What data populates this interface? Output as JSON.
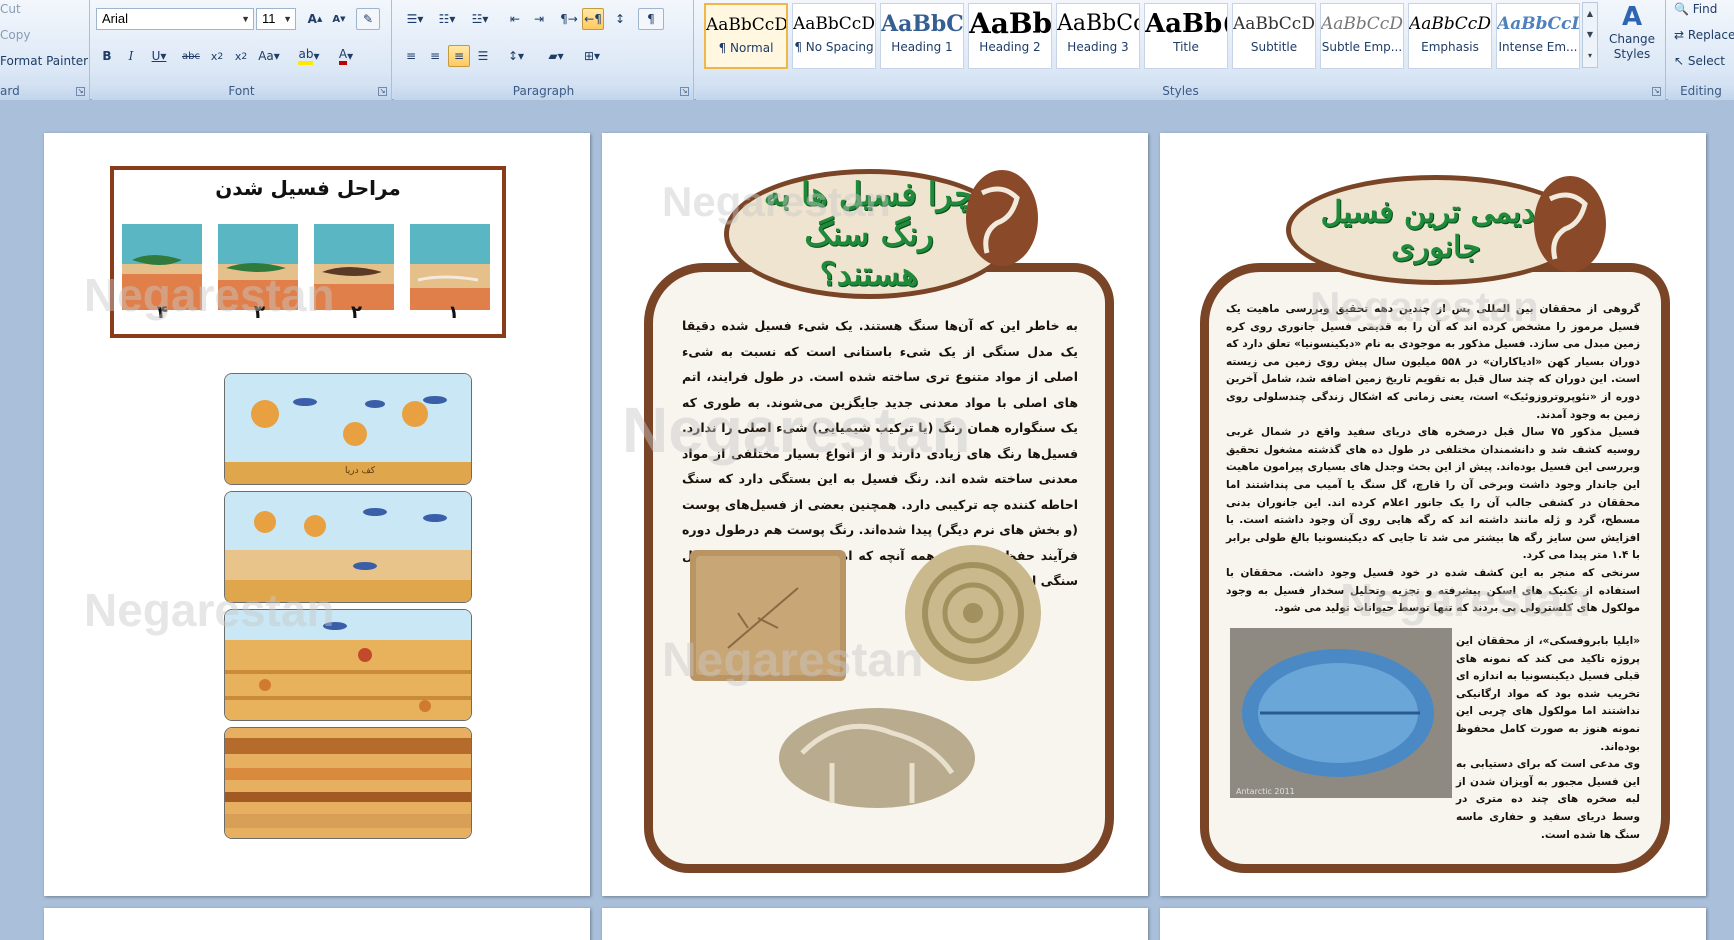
{
  "ribbon": {
    "clipboard": {
      "cut": "Cut",
      "copy": "Copy",
      "format_painter": "Format Painter",
      "label": "ard"
    },
    "font": {
      "name": "Arial",
      "size": "11",
      "label": "Font"
    },
    "paragraph": {
      "label": "Paragraph"
    },
    "styles": {
      "label": "Styles",
      "items": [
        {
          "preview": "AaBbCcDd",
          "name": "¶ Normal"
        },
        {
          "preview": "AaBbCcDd",
          "name": "¶ No Spacing"
        },
        {
          "preview": "AaBbCc",
          "name": "Heading 1"
        },
        {
          "preview": "AaBb",
          "name": "Heading 2"
        },
        {
          "preview": "AaBbCc",
          "name": "Heading 3"
        },
        {
          "preview": "AaBb(",
          "name": "Title"
        },
        {
          "preview": "AaBbCcD",
          "name": "Subtitle"
        },
        {
          "preview": "AaBbCcDd",
          "name": "Subtle Emp..."
        },
        {
          "preview": "AaBbCcDd",
          "name": "Emphasis"
        },
        {
          "preview": "AaBbCcDd",
          "name": "Intense Em..."
        }
      ],
      "change_styles": "Change Styles"
    },
    "editing": {
      "find": "Find",
      "replace": "Replace",
      "select": "Select",
      "label": "Editing"
    }
  },
  "pages": {
    "left": {
      "stages_title": "مراحل فسیل شدن",
      "stage_numbers": [
        "۴",
        "۳",
        "۲",
        "۱"
      ],
      "strip_caption": "کف دریا"
    },
    "middle": {
      "title": "چرا فسیل ها به رنگ سنگ هستند؟",
      "body": "به خاطر این که آن‌ها سنگ هستند. یک شیء فسیل شده دقیقا یک مدل سنگی از یک شیء باستانی است که نسبت به شیء اصلی از مواد متنوع تری ساخته شده است. در طول فرایند، اتم های اصلی با مواد معدنی جدید جایگزین می‌شوند. به طوری که یک سنگواره همان رنگ (یا ترکیب شیمیایی) شیء اصلی را ندارد. فسیل‌ها رنگ های زیادی دارند و از انواع بسیار مختلفی از مواد معدنی ساخته شده اند. رنگ فسیل به این بستگی دارد که سنگ احاطه کننده چه ترکیبی دارد. همچنین بعضی از فسیل‌های پوست (و بخش های نرم دیگر) پیدا شده‌اند. رنگ پوست هم درطول دوره فرآیند حفظ نمی‌شود. همه آنچه که امروزه باقی مانده یک مدل سنگی از شیء اصلی است."
    },
    "right": {
      "title": "قدیمی ترین فسیل جانوری",
      "p1": "گروهی از محققان بین المللی پس از چندین دهه تحقیق وبررسی ماهیت یک فسیل مرموز را مشخص کرده اند که آن را به قدیمی فسیل جانوری روی کره زمین مبدل می سازد. فسیل مذکور به موجودی به نام «دیکینسونیا» تعلق دارد که دوران بسیار کهن «ادیاکاران» در ۵۵۸ میلیون سال پیش روی زمین می زیسته است. این دوران که چند سال قبل به تقویم تاریخ زمین اضافه شد، شامل آخرین دوره از «نئوپروتروزوئیک» است، یعنی زمانی که اشکال زندگی چندسلولی روی زمین به وجود آمدند.",
      "p2": "فسیل مذکور ۷۵ سال قبل درصخره های دریای سفید واقع در شمال غربی روسیه کشف شد و دانشمندان مختلفی در طول ده های گذشته مشغول تحقیق وبررسی این فسیل بوده‌اند. پیش از این بحث وجدل های بسیاری پیرامون ماهیت این جاندار وجود داشت وبرخی آن را قارچ، گل سنگ یا آمیب می پنداشتند اما محققان در کشفی جالب آن را یک جانور اعلام کرده اند. این جانوران بدنی مسطح، گرد و ژله مانند داشته اند که رگه هایی روی آن وجود داشته است. با افزایش سن سایز رگه ها بیشتر می شد تا جایی که دیکینسونیا بالغ طولی برابر با ۱.۴ متر پیدا می کرد.",
      "p3": "سرنخی که منجر به این کشف شده در خود فسیل وجود داشت. محققان با استفاده از تکنیک های اسکن پیشرفته و تجزیه وتحلیل سخدار فسیل به وجود مولکول های کلسترولی پی بردند که تنها توسط حیوانات تولید می شود.",
      "p4": "«ایلیا بابروفسکی»، از محققان این پروژه تاکید می کند که نمونه های قبلی فسیل دیکینسونیا به اندازه ای تخریب شده بود که مواد ارگانیکی نداشتند اما مولکول های چربی این نمونه هنوز به صورت کامل محفوظ بوده‌اند.",
      "p5": "وی مدعی است که برای دستیابی به این فسیل مجبور به آویزان شدن از لبه صخره های چند ده متری در وسط دریای سفید و حفاری ماسه سنگ ها شده است.",
      "photo_caption": "Antarctic 2011"
    },
    "watermark": "Negarestan"
  }
}
